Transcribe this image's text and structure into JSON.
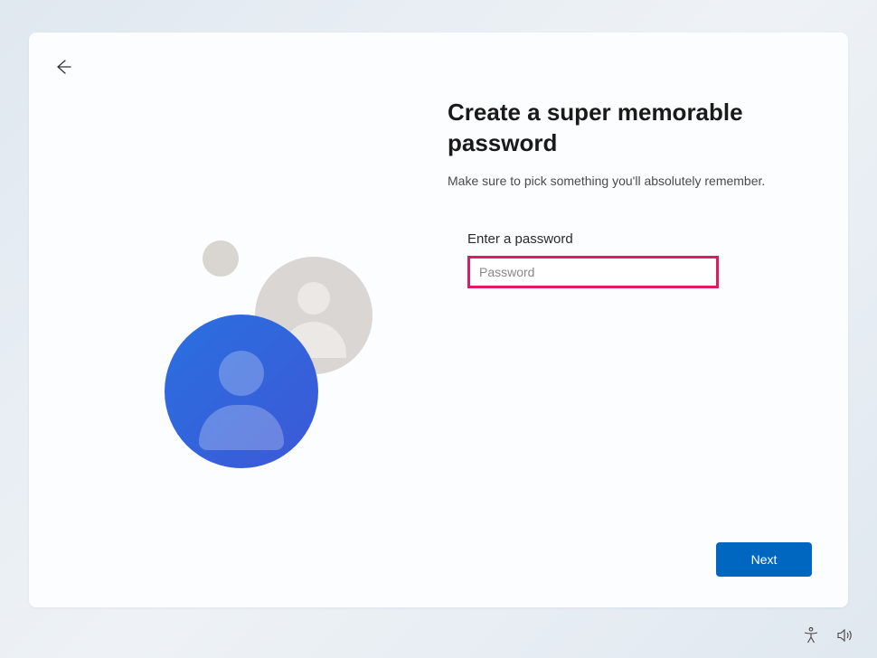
{
  "heading": "Create a super memorable password",
  "subheading": "Make sure to pick something you'll absolutely remember.",
  "field": {
    "label": "Enter a password",
    "placeholder": "Password",
    "value": ""
  },
  "buttons": {
    "next": "Next"
  }
}
